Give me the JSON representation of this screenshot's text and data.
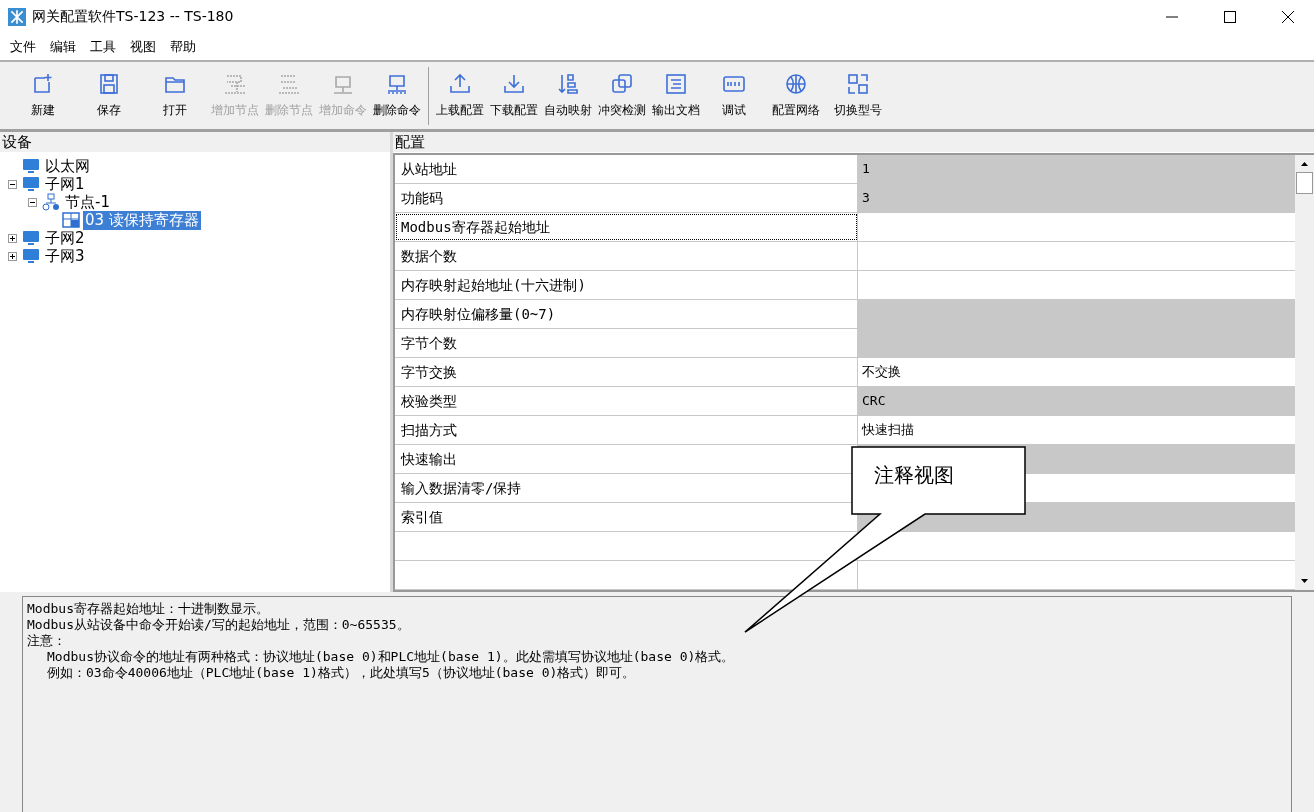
{
  "window": {
    "title": "网关配置软件TS-123 -- TS-180"
  },
  "menu": [
    "文件",
    "编辑",
    "工具",
    "视图",
    "帮助"
  ],
  "toolbar": [
    {
      "label": "新建",
      "disabled": false
    },
    {
      "label": "保存",
      "disabled": false
    },
    {
      "label": "打开",
      "disabled": false
    },
    {
      "label": "增加节点",
      "disabled": true
    },
    {
      "label": "删除节点",
      "disabled": true
    },
    {
      "label": "增加命令",
      "disabled": true
    },
    {
      "label": "删除命令",
      "disabled": false
    },
    {
      "label": "上载配置",
      "disabled": false
    },
    {
      "label": "下载配置",
      "disabled": false
    },
    {
      "label": "自动映射",
      "disabled": false
    },
    {
      "label": "冲突检测",
      "disabled": false
    },
    {
      "label": "输出文档",
      "disabled": false
    },
    {
      "label": "调试",
      "disabled": false
    },
    {
      "label": "配置网络",
      "disabled": false
    },
    {
      "label": "切换型号",
      "disabled": false
    }
  ],
  "device_panel": {
    "title": "设备",
    "tree": [
      {
        "label": "以太网",
        "selected": false
      },
      {
        "label": "子网1",
        "expanded": true,
        "selected": false,
        "children": [
          {
            "label": "节点-1",
            "expanded": true,
            "selected": false,
            "children": [
              {
                "label": "03 读保持寄存器",
                "selected": true
              }
            ]
          }
        ]
      },
      {
        "label": "子网2",
        "expanded": false,
        "selected": false
      },
      {
        "label": "子网3",
        "expanded": false,
        "selected": false
      }
    ]
  },
  "config_panel": {
    "title": "配置",
    "rows": [
      {
        "name": "从站地址",
        "value": "1",
        "readonly": true,
        "selected": false
      },
      {
        "name": "功能码",
        "value": "3",
        "readonly": true,
        "selected": false
      },
      {
        "name": "Modbus寄存器起始地址",
        "value": "",
        "readonly": false,
        "selected": true
      },
      {
        "name": "数据个数",
        "value": "",
        "readonly": false,
        "selected": false
      },
      {
        "name": "内存映射起始地址(十六进制)",
        "value": "",
        "readonly": false,
        "selected": false
      },
      {
        "name": "内存映射位偏移量(0~7)",
        "value": "",
        "readonly": true,
        "selected": false
      },
      {
        "name": "字节个数",
        "value": "",
        "readonly": true,
        "selected": false
      },
      {
        "name": "字节交换",
        "value": "不交换",
        "readonly": false,
        "selected": false
      },
      {
        "name": "校验类型",
        "value": "CRC",
        "readonly": true,
        "selected": false
      },
      {
        "name": "扫描方式",
        "value": "快速扫描",
        "readonly": false,
        "selected": false
      },
      {
        "name": "快速输出",
        "value": "",
        "readonly": true,
        "selected": false
      },
      {
        "name": "输入数据清零/保持",
        "value": "",
        "readonly": false,
        "selected": false
      },
      {
        "name": "索引值",
        "value": "",
        "readonly": true,
        "selected": false
      },
      {
        "name": "",
        "value": "",
        "readonly": false,
        "selected": false
      },
      {
        "name": "",
        "value": "",
        "readonly": false,
        "selected": false
      }
    ]
  },
  "notes": {
    "lines": [
      {
        "text": "Modbus寄存器起始地址：十进制数显示。",
        "indent": false
      },
      {
        "text": "Modbus从站设备中命令开始读/写的起始地址，范围：0~65535。",
        "indent": false
      },
      {
        "text": "注意：",
        "indent": false
      },
      {
        "text": "Modbus协议命令的地址有两种格式：协议地址(base 0)和PLC地址(base 1)。此处需填写协议地址(base 0)格式。",
        "indent": true
      },
      {
        "text": "例如：03命令40006地址（PLC地址(base 1)格式），此处填写5（协议地址(base 0)格式）即可。",
        "indent": true
      }
    ]
  },
  "callout": {
    "text": "注释视图"
  }
}
